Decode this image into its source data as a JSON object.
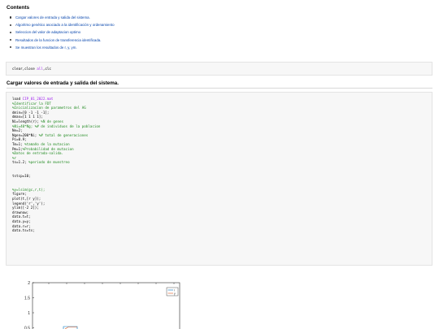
{
  "contents_title": "Contents",
  "toc": [
    "Cargar valores de entrada y salida del sistema.",
    "Algoritmo genético asociado a la identificación y ordenamiento",
    "Seleccion del valor de adaptacion optimo",
    "Resultados de la funcion de transferencia identificada.",
    "Se muestran los resultados de r, y, ym."
  ],
  "code1": "clear,close all,clc",
  "section_title": "Cargar valores de entrada y salida del sistema.",
  "code2": [
    "load CIP_01_2022.mat",
    "%Identificar la FDT",
    "%Inicializacion de parametros del AG",
    "dmin=[0 -1 -1 -1];",
    "dmax=[1 1 1 1];",
    "Ni=length(r); %N de genes",
    "%Ni=40*Ng; %# de individuos de la poblacion",
    "Ne=2;",
    "Ngen=200*Ni; %# total de generaciones",
    "Pc=0.9;",
    "Tm=1; %tamaño de la mutacion",
    "Pm=1;%Probabilidad de mutacion",
    "%Datos de entrada-salida.",
    "%r",
    "ts=1.2; %periodo de muestreo",
    "",
    "",
    "tstcp=10;",
    "",
    "",
    "%y=lsim(gc,r,t);",
    "figure;",
    "plot(t,[r y]);",
    "legend('r','y');",
    "ylim([-2 2]);",
    "drawnow;",
    "data.t=t;",
    "data.y=y;",
    "data.r=r;",
    "data.ts=ts;"
  ],
  "figure": {
    "ytick_labels": [
      "2",
      "1.5",
      "1",
      "0.5"
    ],
    "legend": [
      "r",
      "y"
    ],
    "colors": {
      "r": "#0072bd",
      "y": "#d95319"
    }
  }
}
